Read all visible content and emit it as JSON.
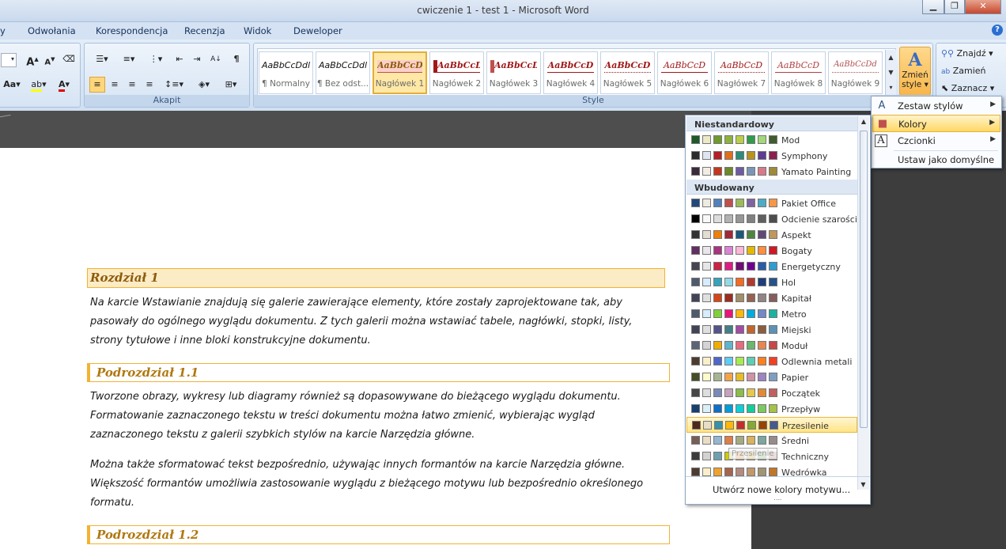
{
  "window": {
    "title": "cwiczenie 1 - test 1 - Microsoft Word",
    "minimize": "▁",
    "restore": "❐",
    "close": "✕",
    "help": "?"
  },
  "menu": {
    "items": [
      "y",
      "Odwołania",
      "Korespondencja",
      "Recenzja",
      "Widok",
      "Deweloper"
    ]
  },
  "ribbon": {
    "groups": {
      "paragraph": "Akapit",
      "styles": "Style"
    },
    "styles": [
      {
        "preview": "AaBbCcDdl",
        "name": "¶ Normalny"
      },
      {
        "preview": "AaBbCcDdl",
        "name": "¶ Bez odst..."
      },
      {
        "preview": "AaBbCcD",
        "name": "Nagłówek 1"
      },
      {
        "preview": "AaBbCcD",
        "name": "Nagłówek 2"
      },
      {
        "preview": "AaBbCcD",
        "name": "Nagłówek 3"
      },
      {
        "preview": "AaBbCcD",
        "name": "Nagłówek 4"
      },
      {
        "preview": "AaBbCcD",
        "name": "Nagłówek 5"
      },
      {
        "preview": "AaBbCcD",
        "name": "Nagłówek 6"
      },
      {
        "preview": "AaBbCcD",
        "name": "Nagłówek 7"
      },
      {
        "preview": "AaBbCcD",
        "name": "Nagłówek 8"
      },
      {
        "preview": "AaBbCcDd",
        "name": "Nagłówek 9"
      }
    ],
    "change_styles": {
      "line1": "Zmień",
      "line2": "style ▾"
    },
    "editing": {
      "find": "Znajdź ▾",
      "replace": "Zamień",
      "select": "Zaznacz ▾"
    }
  },
  "document": {
    "heading1": "Rozdział 1",
    "p1": [
      "Na karcie Wstawianie znajdują się galerie zawierające elementy, które zostały zaprojektowane tak, aby",
      "pasowały do ogólnego wyglądu dokumentu.  Z tych galerii można wstawiać tabele, nagłówki, stopki, listy,",
      "strony tytułowe i inne bloki konstrukcyjne dokumentu."
    ],
    "sub1": "Podrozdział 1.1",
    "p2": [
      "Tworzone obrazy, wykresy lub diagramy również są dopasowywane do bieżącego wyglądu dokumentu.",
      "Formatowanie zaznaczonego tekstu w treści dokumentu można łatwo zmienić, wybierając wygląd",
      "zaznaczonego tekstu z galerii szybkich stylów na karcie Narzędzia główne."
    ],
    "p3": [
      "Można także sformatować tekst bezpośrednio, używając innych formantów na karcie Narzędzia główne.",
      "Większość formantów umożliwia zastosowanie wyglądu z bieżącego motywu lub bezpośrednio określonego",
      "formatu."
    ],
    "sub2": "Podrozdział 1.2"
  },
  "submenu": {
    "items": [
      {
        "label": "Zestaw stylów",
        "icon": "A",
        "arrow": "▶"
      },
      {
        "label": "Kolory",
        "icon": "■",
        "arrow": "▶"
      },
      {
        "label": "Czcionki",
        "icon": "A",
        "arrow": "▶"
      },
      {
        "label": "Ustaw jako domyślne"
      }
    ]
  },
  "gallery": {
    "custom_header": "Niestandardowy",
    "builtin_header": "Wbudowany",
    "tooltip": "Przesilenie",
    "create_new": "Utwórz nowe kolory motywu...",
    "grip": "....",
    "custom": [
      {
        "name": "Mod",
        "colors": [
          "#1d5a2a",
          "#ece9c6",
          "#6e9b2c",
          "#8cb33d",
          "#b9cf4a",
          "#2f9d49",
          "#a2d879",
          "#3e5c2c"
        ]
      },
      {
        "name": "Symphony",
        "colors": [
          "#2b2b2b",
          "#dfe6ef",
          "#b61f24",
          "#e06f1c",
          "#2d8c78",
          "#b8941f",
          "#5c3d91",
          "#8b1f50"
        ]
      },
      {
        "name": "Yamato Painting",
        "colors": [
          "#3a2a3a",
          "#f3ece4",
          "#c2381f",
          "#6c8a2a",
          "#6e5ba2",
          "#7a96b7",
          "#d87a8a",
          "#9e8a3a"
        ]
      }
    ],
    "builtin": [
      {
        "name": "Pakiet Office",
        "colors": [
          "#1f497d",
          "#eeece1",
          "#4f81bd",
          "#c0504d",
          "#9bbb59",
          "#8064a2",
          "#4bacc6",
          "#f79646"
        ]
      },
      {
        "name": "Odcienie szarości",
        "colors": [
          "#000000",
          "#f8f8f8",
          "#dddddd",
          "#b2b2b2",
          "#969696",
          "#808080",
          "#5f5f5f",
          "#4d4d4d"
        ]
      },
      {
        "name": "Aspekt",
        "colors": [
          "#323232",
          "#e3ded1",
          "#f07f09",
          "#9f2936",
          "#1b587c",
          "#4e8542",
          "#604878",
          "#c19859"
        ]
      },
      {
        "name": "Bogaty",
        "colors": [
          "#632e62",
          "#eae5eb",
          "#a9347f",
          "#dc84d3",
          "#ffb7d6",
          "#e6b800",
          "#ff8e3f",
          "#ce1a24"
        ]
      },
      {
        "name": "Energetyczny",
        "colors": [
          "#454551",
          "#e6e6e6",
          "#cc2244",
          "#e01b84",
          "#700c73",
          "#6e0090",
          "#2a5ba6",
          "#2f9dd1"
        ]
      },
      {
        "name": "Hol",
        "colors": [
          "#4e5b6f",
          "#d6ecff",
          "#37a3bb",
          "#94d9e5",
          "#f36c25",
          "#b03a2e",
          "#1d3f7b",
          "#25548a"
        ]
      },
      {
        "name": "Kapitał",
        "colors": [
          "#424456",
          "#dedfde",
          "#d34817",
          "#9b2d1f",
          "#a28e6a",
          "#956251",
          "#918485",
          "#855d5d"
        ]
      },
      {
        "name": "Metro",
        "colors": [
          "#4e5b6f",
          "#d6ecff",
          "#7fd13b",
          "#ea157a",
          "#feb80a",
          "#00addc",
          "#738ac8",
          "#1ab39f"
        ]
      },
      {
        "name": "Miejski",
        "colors": [
          "#424456",
          "#dedfde",
          "#53548a",
          "#438086",
          "#a04da3",
          "#c4652d",
          "#8b5d3d",
          "#5c92b5"
        ]
      },
      {
        "name": "Moduł",
        "colors": [
          "#5a6378",
          "#d4d4d6",
          "#f0ad00",
          "#60b5cc",
          "#e66c7d",
          "#6bb76d",
          "#e88651",
          "#c64847"
        ]
      },
      {
        "name": "Odlewnia metali",
        "colors": [
          "#4e3b30",
          "#fbeec9",
          "#4e67c8",
          "#5eccf3",
          "#a7ea52",
          "#5dceaf",
          "#ff8021",
          "#f14124"
        ]
      },
      {
        "name": "Papier",
        "colors": [
          "#444d26",
          "#fefac9",
          "#a5b592",
          "#f3a447",
          "#e7bc29",
          "#d092a7",
          "#9c85c0",
          "#809ec2"
        ]
      },
      {
        "name": "Początek",
        "colors": [
          "#464646",
          "#dedede",
          "#7a8ab8",
          "#c6a3bc",
          "#8bbd4a",
          "#e6c84c",
          "#e08a37",
          "#c16060"
        ]
      },
      {
        "name": "Przepływ",
        "colors": [
          "#17406d",
          "#dbeff9",
          "#0f6fc6",
          "#009dd9",
          "#0bd0d9",
          "#10cf9b",
          "#7cca62",
          "#a5c249"
        ]
      },
      {
        "name": "Przesilenie",
        "colors": [
          "#4f271c",
          "#e7dec9",
          "#3891a7",
          "#feb80a",
          "#c32d2e",
          "#84aa33",
          "#964305",
          "#475a8d"
        ]
      },
      {
        "name": "Średni",
        "colors": [
          "#775f55",
          "#ebddc3",
          "#94b6d2",
          "#dd8047",
          "#a5ab81",
          "#d8b25c",
          "#7ba79d",
          "#968c8c"
        ]
      },
      {
        "name": "Techniczny",
        "colors": [
          "#3b3b3b",
          "#d4d2d0",
          "#6ea0b0",
          "#cccc00",
          "#ee7b08",
          "#cc9900",
          "#5c9b3a",
          "#b06056"
        ]
      },
      {
        "name": "Wędrówka",
        "colors": [
          "#4e3b30",
          "#fbeec9",
          "#f0a22e",
          "#a5644e",
          "#b58b80",
          "#c3986d",
          "#a19574",
          "#c17529"
        ]
      }
    ]
  }
}
